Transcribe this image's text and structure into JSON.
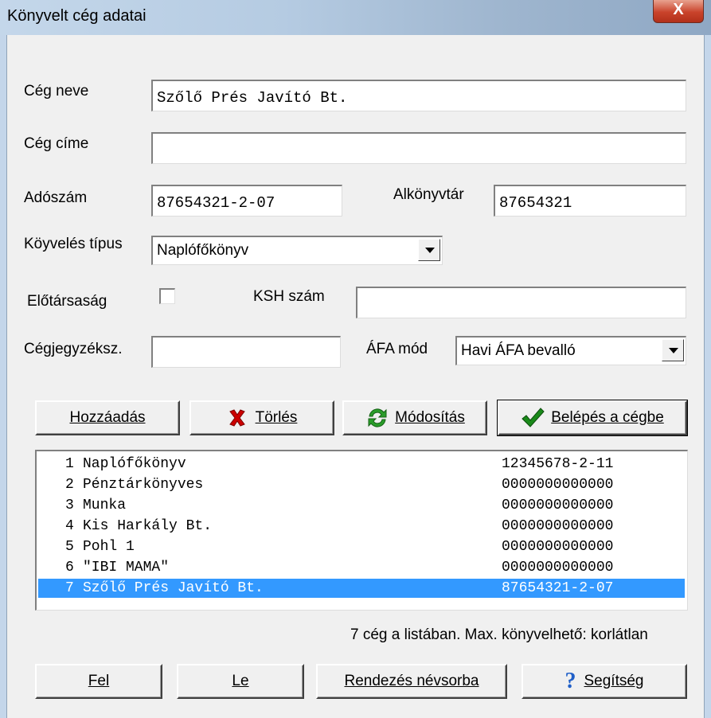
{
  "window": {
    "title": "Könyvelt cég adatai",
    "close": "X"
  },
  "form": {
    "ceg_neve_label": "Cég neve",
    "ceg_neve_value": "Szőlő Prés Javító Bt.",
    "ceg_cime_label": "Cég címe",
    "ceg_cime_value": "",
    "adoszam_label": "Adószám",
    "adoszam_value": "87654321-2-07",
    "alkonyvtar_label": "Alkönyvtár",
    "alkonyvtar_value": "87654321",
    "konyveles_tipus_label": "Köyvelés típus",
    "konyveles_tipus_value": "Naplófőkönyv",
    "elotarsasag_label": "Előtársaság",
    "elotarsasag_checked": false,
    "ksh_label": "KSH szám",
    "ksh_value": "",
    "cegjegyzek_label": "Cégjegyzéksz.",
    "cegjegyzek_value": "",
    "afa_mod_label": "ÁFA mód",
    "afa_mod_value": "Havi ÁFA bevalló"
  },
  "actions": {
    "add": "Hozzáadás",
    "delete": "Törlés",
    "modify": "Módosítás",
    "enter": "Belépés a cégbe"
  },
  "companies": [
    {
      "num": "1",
      "name": "Naplófőkönyv",
      "tax": "12345678-2-11"
    },
    {
      "num": "2",
      "name": "Pénztárkönyves",
      "tax": "0000000000000"
    },
    {
      "num": "3",
      "name": "Munka",
      "tax": "0000000000000"
    },
    {
      "num": "4",
      "name": "Kis Harkály Bt.",
      "tax": "0000000000000"
    },
    {
      "num": "5",
      "name": "Pohl 1",
      "tax": "0000000000000"
    },
    {
      "num": "6",
      "name": "\"IBI MAMA\"",
      "tax": "0000000000000"
    },
    {
      "num": "7",
      "name": "Szőlő Prés Javító Bt.",
      "tax": "87654321-2-07"
    }
  ],
  "selected_company": 7,
  "status": "7 cég a listában. Max. könyvelhető: korlátlan",
  "bottom": {
    "up": "Fel",
    "down": "Le",
    "sort": "Rendezés névsorba",
    "help": "Segítség"
  },
  "icons": {
    "delete": "x-icon",
    "modify": "refresh-icon",
    "enter": "checkmark-icon",
    "help": "question-icon"
  },
  "colors": {
    "selection": "#3399ff",
    "delete_icon": "#cc0000",
    "check_icon": "#1a8a1a",
    "help_icon": "#1f5fc8"
  }
}
